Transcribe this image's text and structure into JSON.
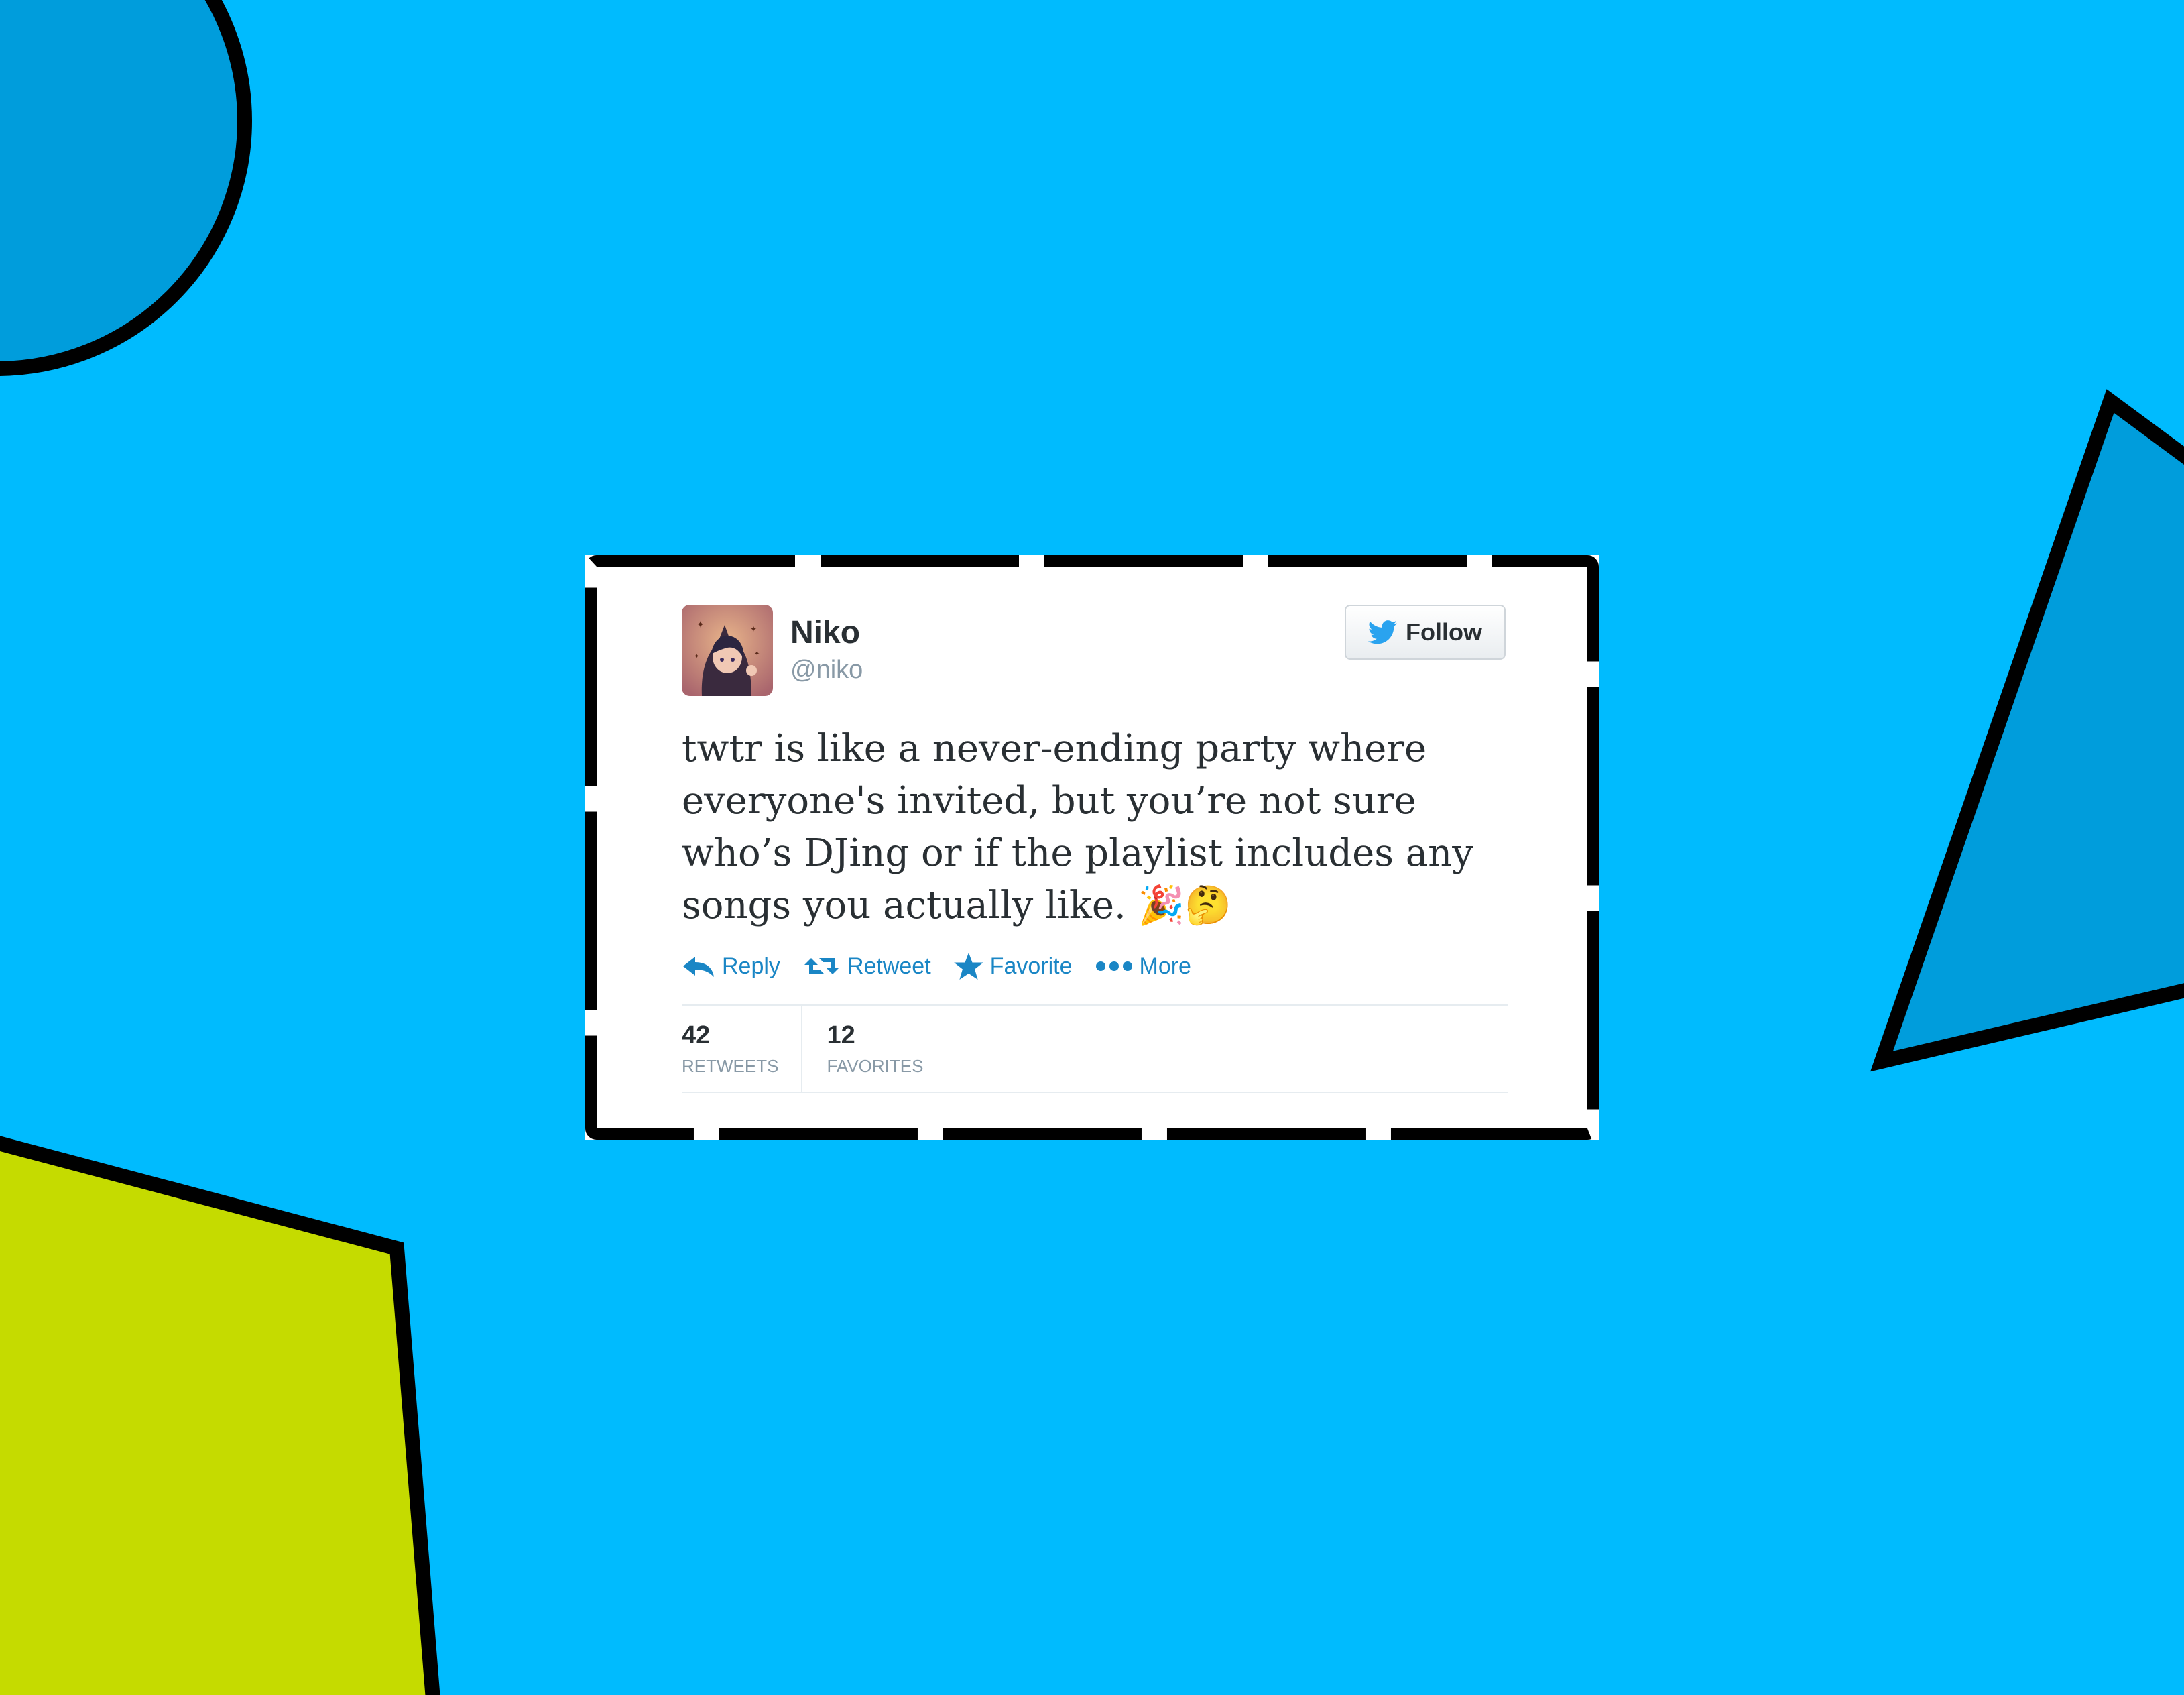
{
  "background": {
    "color": "#00bbfe",
    "shapes": [
      "circle",
      "triangle",
      "quadrilateral"
    ],
    "shape_colors": {
      "circle": "#009ddc",
      "triangle": "#009ddc",
      "quadrilateral": "#c5db00",
      "outline": "#000000"
    }
  },
  "tweet": {
    "display_name": "Niko",
    "handle": "@niko",
    "avatar_icon": "avatar-anime-character",
    "follow_label": "Follow",
    "text": "twtr is like a never-ending party where everyone's invited, but you’re not sure who’s DJing or if the playlist includes any songs you actually like. 🎉🤔",
    "actions": {
      "reply": "Reply",
      "retweet": "Retweet",
      "favorite": "Favorite",
      "more": "More"
    },
    "stats": {
      "retweets_count": "42",
      "retweets_label": "RETWEETS",
      "favorites_count": "12",
      "favorites_label": "FAVORITES"
    },
    "accent_color": "#1a86c5"
  }
}
